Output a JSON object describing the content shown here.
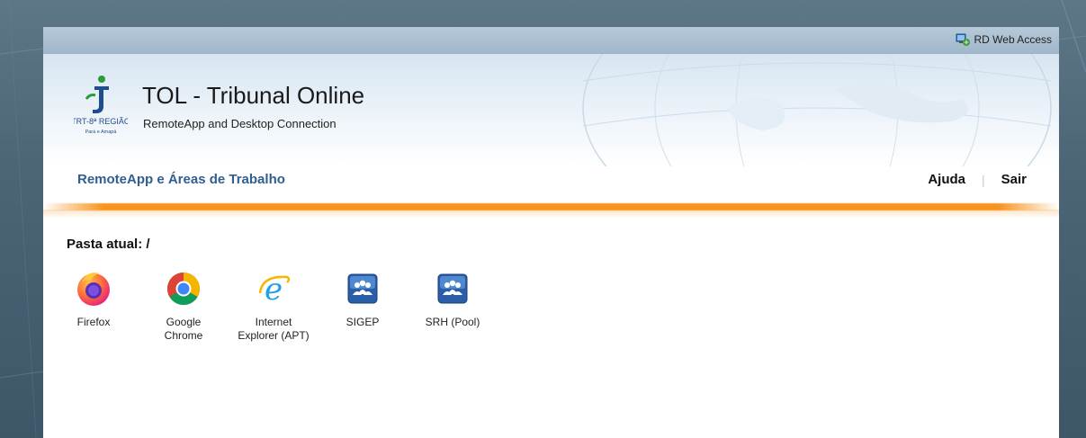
{
  "header": {
    "rd_web_access": "RD Web Access",
    "title": "TOL - Tribunal Online",
    "subtitle": "RemoteApp and Desktop Connection",
    "logo_text_line1": "TRT-8ª REGIÃO",
    "logo_text_line2": "Pará e Amapá"
  },
  "nav": {
    "section_title": "RemoteApp e Áreas de Trabalho",
    "help_label": "Ajuda",
    "signout_label": "Sair"
  },
  "folder": {
    "label": "Pasta atual: /"
  },
  "apps": [
    {
      "name": "Firefox",
      "icon": "firefox-icon"
    },
    {
      "name": "Google\nChrome",
      "icon": "chrome-icon"
    },
    {
      "name": "Internet\nExplorer (APT)",
      "icon": "internet-explorer-icon"
    },
    {
      "name": "SIGEP",
      "icon": "remoteapp-people-icon"
    },
    {
      "name": "SRH (Pool)",
      "icon": "remoteapp-people-icon"
    }
  ],
  "colors": {
    "accent_orange": "#f7941d",
    "nav_blue": "#2e5f8f"
  }
}
